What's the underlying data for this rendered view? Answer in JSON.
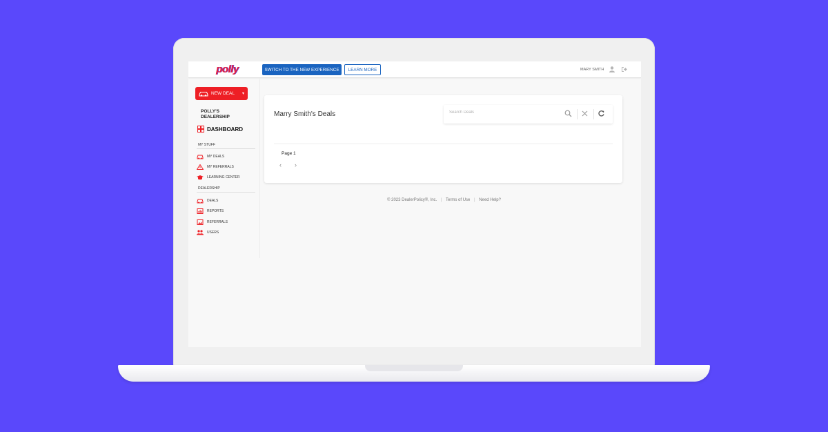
{
  "header": {
    "logo": "polly",
    "switch_button": "SWITCH TO THE NEW EXPERIENCE",
    "learn_more_button": "LEARN MORE",
    "username": "MARY SMITH"
  },
  "sidebar": {
    "new_deal": "NEW DEAL",
    "dealer_name": "POLLY'S DEALERSHIP",
    "dashboard": "DASHBOARD",
    "sections": [
      {
        "label": "MY STUFF",
        "items": [
          "MY DEALS",
          "MY REFERRALS",
          "LEARNING CENTER"
        ]
      },
      {
        "label": "DEALERSHIP",
        "items": [
          "DEALS",
          "REPORTS",
          "REFERRALS",
          "USERS"
        ]
      }
    ]
  },
  "main": {
    "title": "Marry Smith's Deals",
    "search_placeholder": "Search Deals",
    "page_label": "Page 1"
  },
  "footer": {
    "copyright": "© 2023 DealerPolicy®, Inc.",
    "terms": "Terms of Use",
    "help": "Need Help?"
  },
  "colors": {
    "background": "#5a48fb",
    "brand_red": "#ee1f25",
    "primary_blue": "#1a64c0"
  }
}
